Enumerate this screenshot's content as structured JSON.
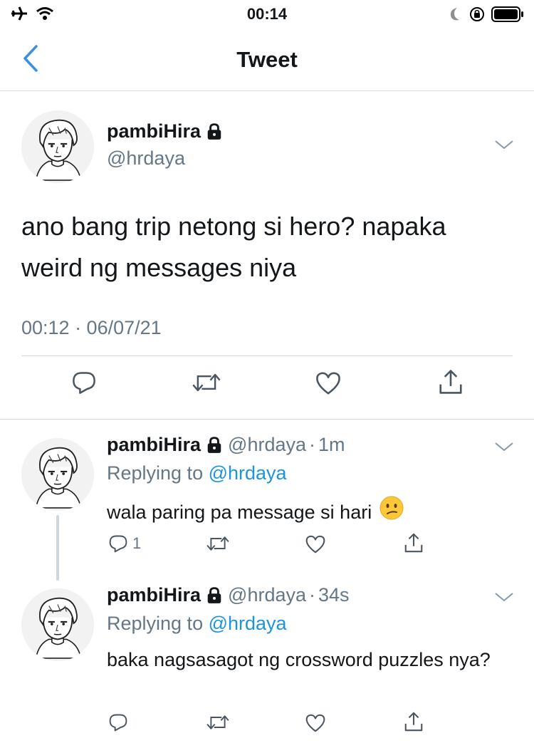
{
  "status_bar": {
    "time": "00:14",
    "icons": [
      "airplane-icon",
      "wifi-icon",
      "moon-icon",
      "orientation-lock-icon",
      "battery-icon"
    ]
  },
  "nav": {
    "title": "Tweet",
    "back_icon": "chevron-left-icon"
  },
  "colors": {
    "accent": "#1b95e0",
    "secondary_text": "#657786",
    "divider": "#d9d9d9",
    "back_arrow": "#3a8ee6"
  },
  "main_tweet": {
    "display_name": "pambiHira",
    "handle": "@hrdaya",
    "text": "ano bang trip netong si hero? napaka weird ng messages niya",
    "timestamp": "00:12 · 06/07/21",
    "actions": [
      "reply-icon",
      "retweet-icon",
      "like-icon",
      "share-icon"
    ]
  },
  "replies": [
    {
      "display_name": "pambiHira",
      "handle": "@hrdaya",
      "separator": "·",
      "age": "1m",
      "replying_label": "Replying to",
      "replying_to": "@hrdaya",
      "text": "wala paring pa message si hari",
      "emoji": "confused-face-emoji",
      "reply_count": "1"
    },
    {
      "display_name": "pambiHira",
      "handle": "@hrdaya",
      "separator": "·",
      "age": "34s",
      "replying_label": "Replying to",
      "replying_to": "@hrdaya",
      "text": "baka nagsasagot ng crossword puzzles nya?",
      "reply_count": ""
    }
  ]
}
